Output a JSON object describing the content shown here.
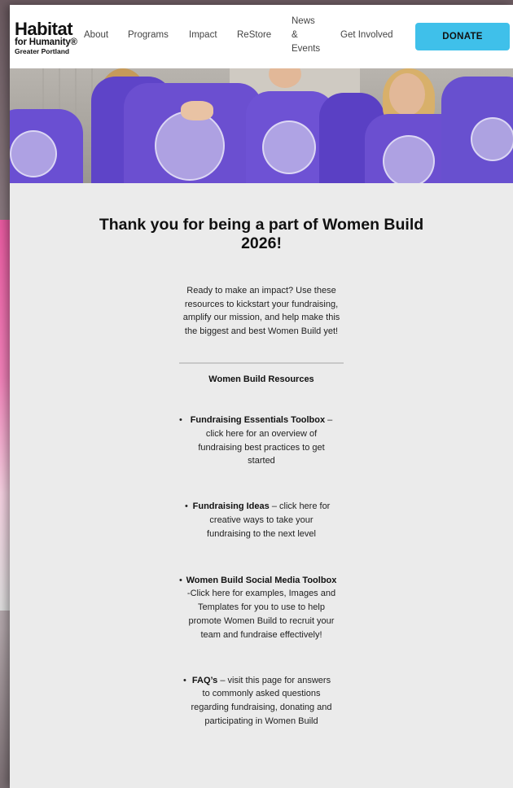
{
  "logo": {
    "line1": "Habitat",
    "line2": "for Humanity®",
    "line3": "Greater Portland"
  },
  "nav": {
    "about": "About",
    "programs": "Programs",
    "impact": "Impact",
    "restore": "ReStore",
    "news_line1": "News",
    "news_line2": "&",
    "news_line3": "Events",
    "get_involved": "Get Involved",
    "donate": "DONATE"
  },
  "colors": {
    "donate_bg": "#3fc0ea",
    "shirt_purple": "#6b4fd0",
    "page_bg": "#ebebeb"
  },
  "main": {
    "title": "Thank you for being a part of Women Build 2026!",
    "intro": "Ready to make an impact? Use these resources to kickstart your fundraising, amplify our mission, and help make this the biggest and best Women Build yet!",
    "resources_title": "Women Build Resources",
    "resources": [
      {
        "bold": "Fundraising Essentials Toolbox",
        "text": " – click here for an overview of fundraising best practices to get started"
      },
      {
        "bold": "Fundraising Ideas",
        "text": " – click here for creative ways to take your fundraising to the next level"
      },
      {
        "bold": "Women Build Social Media Toolbox",
        "text": " -Click here for examples, Images and Templates for you to use to help promote Women Build to recruit your team and fundraise effectively!"
      },
      {
        "bold": "FAQ’s",
        "text": " – visit this page for answers to commonly asked questions regarding fundraising, donating and participating in Women Build"
      }
    ]
  }
}
